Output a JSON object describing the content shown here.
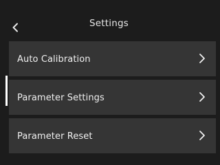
{
  "header": {
    "title": "Settings",
    "back_icon": "chevron-left-icon"
  },
  "menu": {
    "items": [
      {
        "label": "Auto Calibration",
        "icon": "chevron-right-icon",
        "selected": false
      },
      {
        "label": "Parameter Settings",
        "icon": "chevron-right-icon",
        "selected": true
      },
      {
        "label": "Parameter Reset",
        "icon": "chevron-right-icon",
        "selected": false
      }
    ]
  },
  "colors": {
    "background": "#1c1c1c",
    "item_background": "#353535",
    "text": "#f0f0f0",
    "selection_indicator": "#ffffff"
  }
}
